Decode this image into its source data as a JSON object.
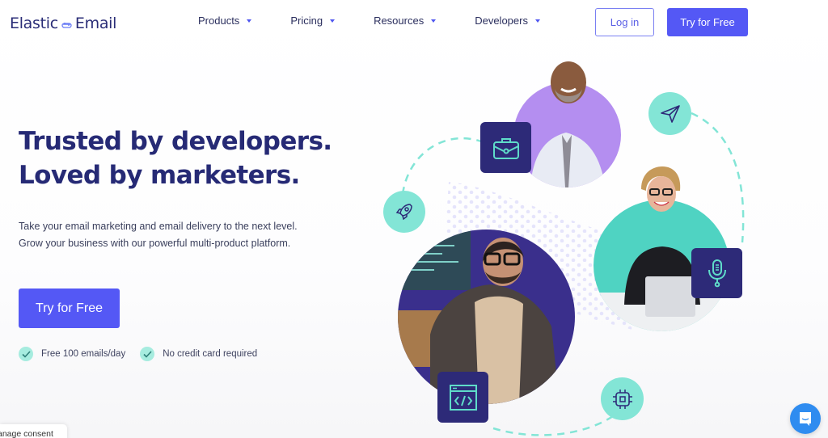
{
  "header": {
    "logo_left": "Elastic",
    "logo_right": "Email",
    "nav": [
      {
        "label": "Products"
      },
      {
        "label": "Pricing"
      },
      {
        "label": "Resources"
      },
      {
        "label": "Developers"
      }
    ],
    "login_label": "Log in",
    "try_label": "Try for Free"
  },
  "hero": {
    "title_line1": "Trusted by developers.",
    "title_line2": "Loved by marketers.",
    "subtitle_line1": "Take your email marketing and email delivery to the next level.",
    "subtitle_line2": "Grow your business with our powerful multi-product platform.",
    "cta_label": "Try for Free",
    "perks": [
      {
        "label": "Free 100 emails/day",
        "icon": "check-icon"
      },
      {
        "label": "No credit card required",
        "icon": "check-icon"
      }
    ]
  },
  "illustration": {
    "icons": [
      "briefcase-icon",
      "rocket-icon",
      "paper-plane-icon",
      "microphone-icon",
      "code-window-icon",
      "chip-icon"
    ],
    "colors": {
      "accent": "#5458f5",
      "teal": "#83e5d6",
      "navy": "#2d2a78",
      "purple": "#b48ef0",
      "teal_dark": "#4fd3c2"
    }
  },
  "consent": {
    "label": "anage consent"
  },
  "chat": {
    "icon": "chat-icon"
  }
}
